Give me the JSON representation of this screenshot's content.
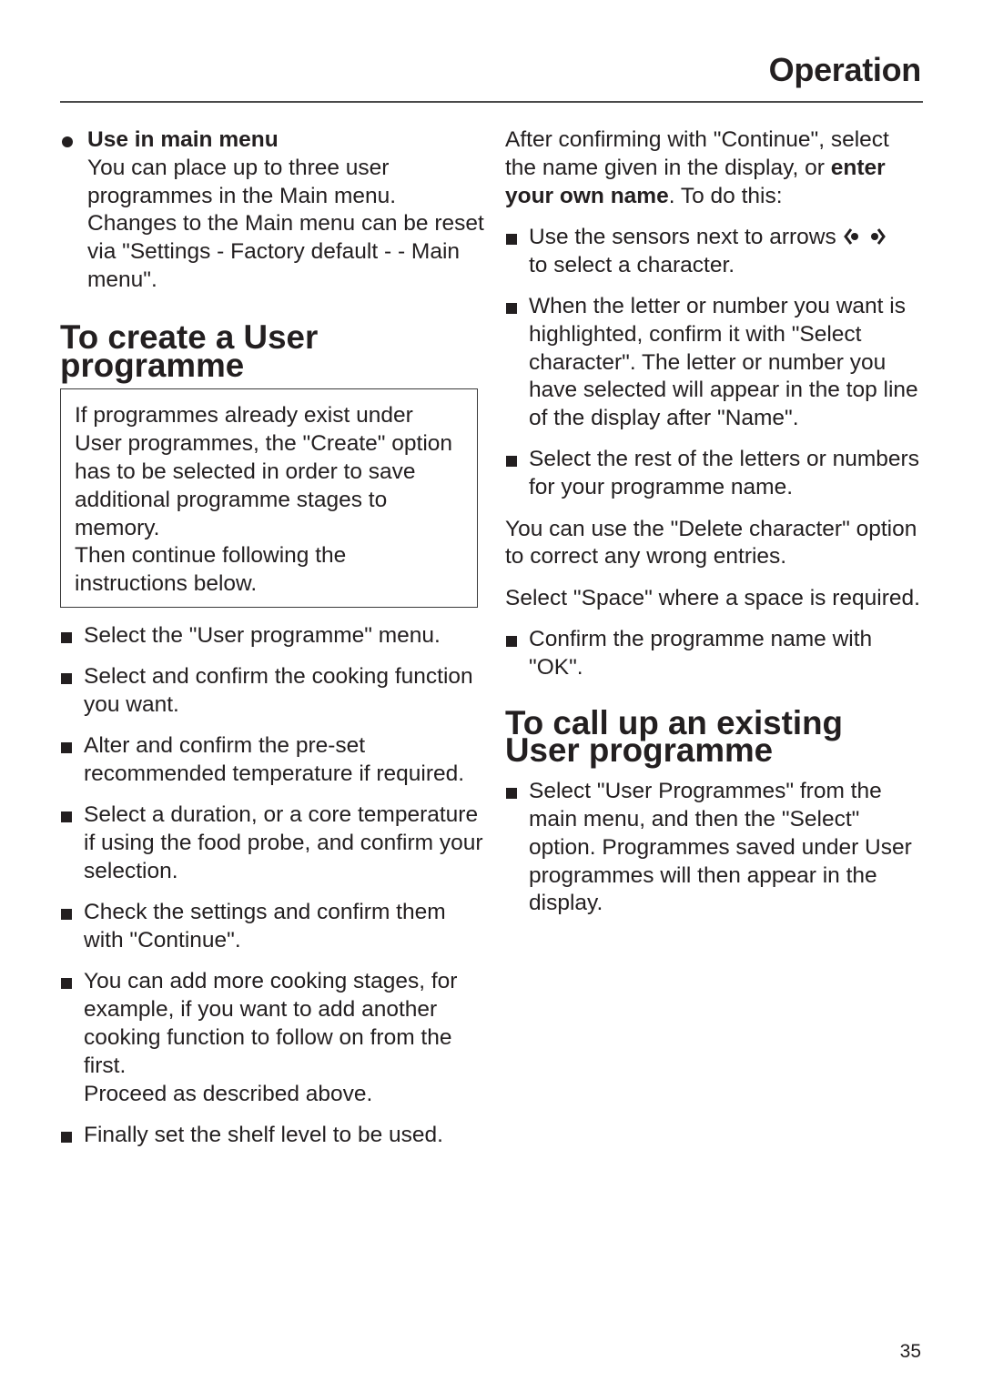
{
  "header": {
    "title": "Operation"
  },
  "left_column": {
    "use_in_main_menu": {
      "bullet_icon": "filled-circle-bullet",
      "title": "Use in main menu",
      "text": "You can place up to three user programmes in the Main menu. Changes to the Main menu can be reset via \"Settings - Factory default - - Main menu\"."
    },
    "create_heading": "To create a User programme",
    "note_box": {
      "paragraph_1": "If programmes already exist under User programmes, the \"Create\" option has to be selected in order to save additional programme stages to memory.",
      "paragraph_2": "Then continue following the instructions below."
    },
    "steps": [
      {
        "text": "Select the \"User programme\" menu."
      },
      {
        "text": "Select and confirm the cooking function you want."
      },
      {
        "text": "Alter and confirm the pre-set recommended temperature if required."
      },
      {
        "text": "Select a duration, or a core temperature if using the food probe, and confirm your selection."
      },
      {
        "text": "Check the settings and confirm them with \"Continue\"."
      },
      {
        "text": "You can add more cooking stages, for example, if you want to add another cooking function to follow on from the first.",
        "extra": "Proceed as described above."
      },
      {
        "text": "Finally set the shelf level to be used."
      }
    ]
  },
  "right_column": {
    "intro": {
      "text_before": "After confirming with \"Continue\", select the name given in the display, or ",
      "bold": "enter your own name",
      "text_after": ". To do this:"
    },
    "name_steps": [
      {
        "text": "Use the sensors next to arrows",
        "icons": [
          "arrow-left-sensor-icon",
          "arrow-right-sensor-icon"
        ],
        "text_after": "to select a character."
      },
      {
        "text": "When the letter or number you want is highlighted, confirm it with \"Select character\".  The letter or number you have selected will appear in the top line of the display after \"Name\"."
      },
      {
        "text": "Select the rest of the letters or numbers for your programme name."
      }
    ],
    "delete_note": "You can use the \"Delete character\" option to correct any wrong entries.",
    "space_note": "Select \"Space\" where a space is required.",
    "confirm_step": "Confirm the programme name with \"OK\".",
    "call_up_heading": "To call up an existing User programme",
    "call_up_steps": [
      {
        "text": "Select \"User Programmes\" from the main menu, and then the \"Select\" option. Programmes saved under User programmes will then appear in the display."
      }
    ]
  },
  "footer": {
    "page_number": "35"
  },
  "colors": {
    "text": "#231f20",
    "rule": "#4a4a4a",
    "background": "#ffffff"
  }
}
